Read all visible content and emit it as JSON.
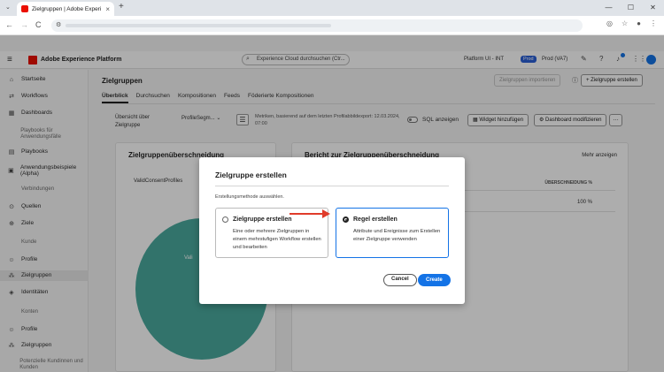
{
  "browser": {
    "tab_title": "Zielgruppen | Adobe Experience",
    "new_tab": "+",
    "back": "←",
    "forward": "→",
    "reload": "C"
  },
  "app": {
    "name": "Adobe Experience Platform",
    "search_placeholder": "Experience Cloud durchsuchen (Ctr...",
    "org": "Platform UI - INT",
    "sandbox_badge": "Prod",
    "sandbox_name": "Prod (VA7)"
  },
  "sidebar": {
    "items": [
      {
        "label": "Startseite",
        "icon": "home-icon"
      },
      {
        "label": "Workflows",
        "icon": "workflow-icon"
      },
      {
        "label": "Dashboards",
        "icon": "dashboard-icon"
      },
      {
        "label": "Playbooks für Anwendungsfälle",
        "icon": "playbook-icon"
      },
      {
        "label": "Playbooks",
        "icon": "playbook-icon"
      },
      {
        "label": "Anwendungsbeispiele (Alpha)",
        "icon": "example-icon"
      },
      {
        "label": "Verbindungen",
        "icon": "section"
      },
      {
        "label": "Quellen",
        "icon": "source-icon"
      },
      {
        "label": "Ziele",
        "icon": "destination-icon"
      },
      {
        "label": "Kunde",
        "icon": "section"
      },
      {
        "label": "Profile",
        "icon": "profile-icon"
      },
      {
        "label": "Zielgruppen",
        "icon": "audience-icon"
      },
      {
        "label": "Identitäten",
        "icon": "identity-icon"
      },
      {
        "label": "Konten",
        "icon": "section"
      },
      {
        "label": "Profile",
        "icon": "profile-icon"
      },
      {
        "label": "Zielgruppen",
        "icon": "audience-icon"
      },
      {
        "label": "Potenzielle Kundinnen und Kunden",
        "icon": "section"
      }
    ]
  },
  "page": {
    "title": "Zielgruppen",
    "import_button": "Zielgruppen importieren",
    "create_button": "Zielgruppe erstellen",
    "tabs": [
      "Überblick",
      "Durchsuchen",
      "Kompositionen",
      "Feeds",
      "Föderierte Kompositionen"
    ],
    "toolbar_label": "Übersicht über Zielgruppe",
    "profile_select": "ProfileSegm...",
    "metric_text": "Metriken, basierend auf dem letzten Profilabbildexport: 12.03.2024, 07:00",
    "sql_label": "SQL anzeigen",
    "add_widget": "Widget hinzufügen",
    "modify_dashboard": "Dashboard modifizieren"
  },
  "cards": {
    "overlap_title": "Zielgruppenüberschneidung",
    "overlap_select": "ValidConsentProfiles",
    "pie_label": "Vali",
    "report_title": "Bericht zur Zielgruppenüberschneidung",
    "show_more": "Mehr anzeigen",
    "col_header": "ÜBERSCHNEIDUNG %",
    "row_value": "100 %"
  },
  "modal": {
    "title": "Zielgruppe erstellen",
    "subtitle": "Erstellungsmethode auswählen.",
    "option1_title": "Zielgruppe erstellen",
    "option1_desc": "Eine oder mehrere Zielgruppen in einem mehrstufigen Workflow erstellen und bearbeiten",
    "option2_title": "Regel erstellen",
    "option2_desc": "Attribute und Ereignisse zum Erstellen einer Zielgruppe verwenden",
    "cancel": "Cancel",
    "create": "Create"
  },
  "colors": {
    "accent": "#1473e6",
    "pie": "#4aaa9e",
    "arrow": "#e03b2a",
    "adobe_red": "#eb1000"
  }
}
